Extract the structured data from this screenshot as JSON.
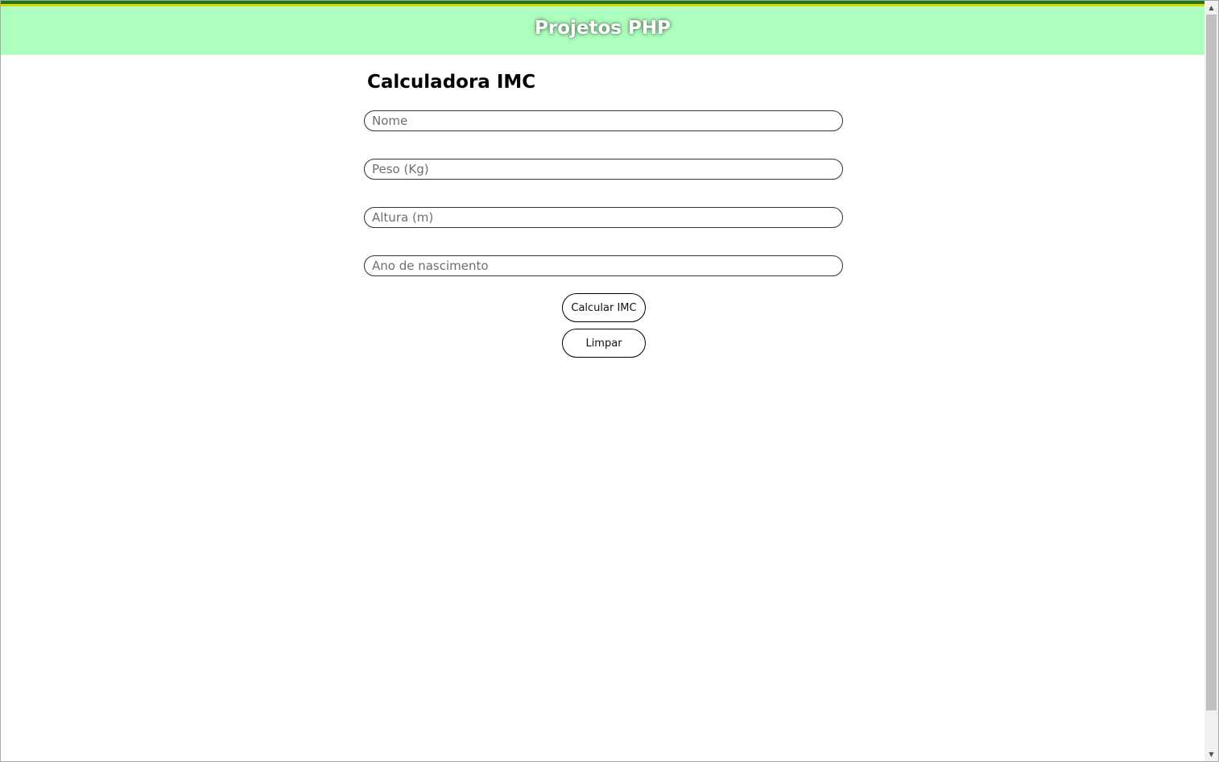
{
  "header": {
    "title": "Projetos PHP"
  },
  "form": {
    "title": "Calculadora IMC",
    "fields": [
      {
        "placeholder": "Nome",
        "value": ""
      },
      {
        "placeholder": "Peso (Kg)",
        "value": ""
      },
      {
        "placeholder": "Altura (m)",
        "value": ""
      },
      {
        "placeholder": "Ano de nascimento",
        "value": ""
      }
    ],
    "calculate_label": "Calcular IMC",
    "clear_label": "Limpar"
  },
  "colors": {
    "header_bg": "#adffbd",
    "stripe_green": "#1c7a12",
    "stripe_yellow": "#e6d600",
    "header_text": "#ffffff"
  },
  "scrollbar": {
    "up_icon": "scroll-up-arrow-icon",
    "down_icon": "scroll-down-arrow-icon"
  }
}
